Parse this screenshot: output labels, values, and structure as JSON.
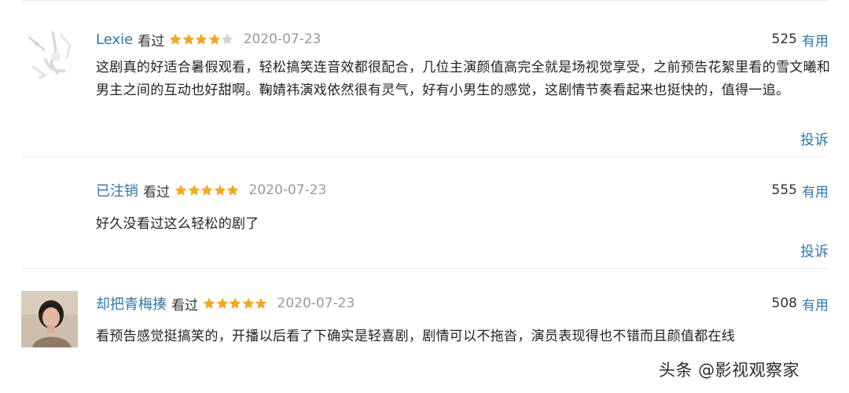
{
  "comments": [
    {
      "user": "Lexie",
      "status": "看过",
      "rating": 4,
      "date": "2020-07-23",
      "votes": "525",
      "vote_label": "有用",
      "text": "这剧真的好适合暑假观看，轻松搞笑连音效都很配合，几位主演颜值高完全就是场视觉享受，之前预告花絮里看的雪文曦和男主之间的互动也好甜啊。鞠婧祎演戏依然很有灵气，好有小男生的感觉，这剧情节奏看起来也挺快的，值得一追。",
      "report_label": "投诉",
      "avatar": "sketch-avatar"
    },
    {
      "user": "已注销",
      "status": "看过",
      "rating": 5,
      "date": "2020-07-23",
      "votes": "555",
      "vote_label": "有用",
      "text": "好久没看过这么轻松的剧了",
      "report_label": "投诉"
    },
    {
      "user": "却把青梅揍",
      "status": "看过",
      "rating": 5,
      "date": "2020-07-23",
      "votes": "508",
      "vote_label": "有用",
      "text": "看预告感觉挺搞笑的，开播以后看了下确实是轻喜剧，剧情可以不拖沓，演员表现得也不错而且颜值都在线",
      "avatar": "photo-avatar"
    }
  ],
  "watermark": "头条 @影视观察家",
  "colors": {
    "link": "#3377aa",
    "star_on": "#f5a623",
    "star_off": "#d4d4d4",
    "date": "#999999"
  }
}
